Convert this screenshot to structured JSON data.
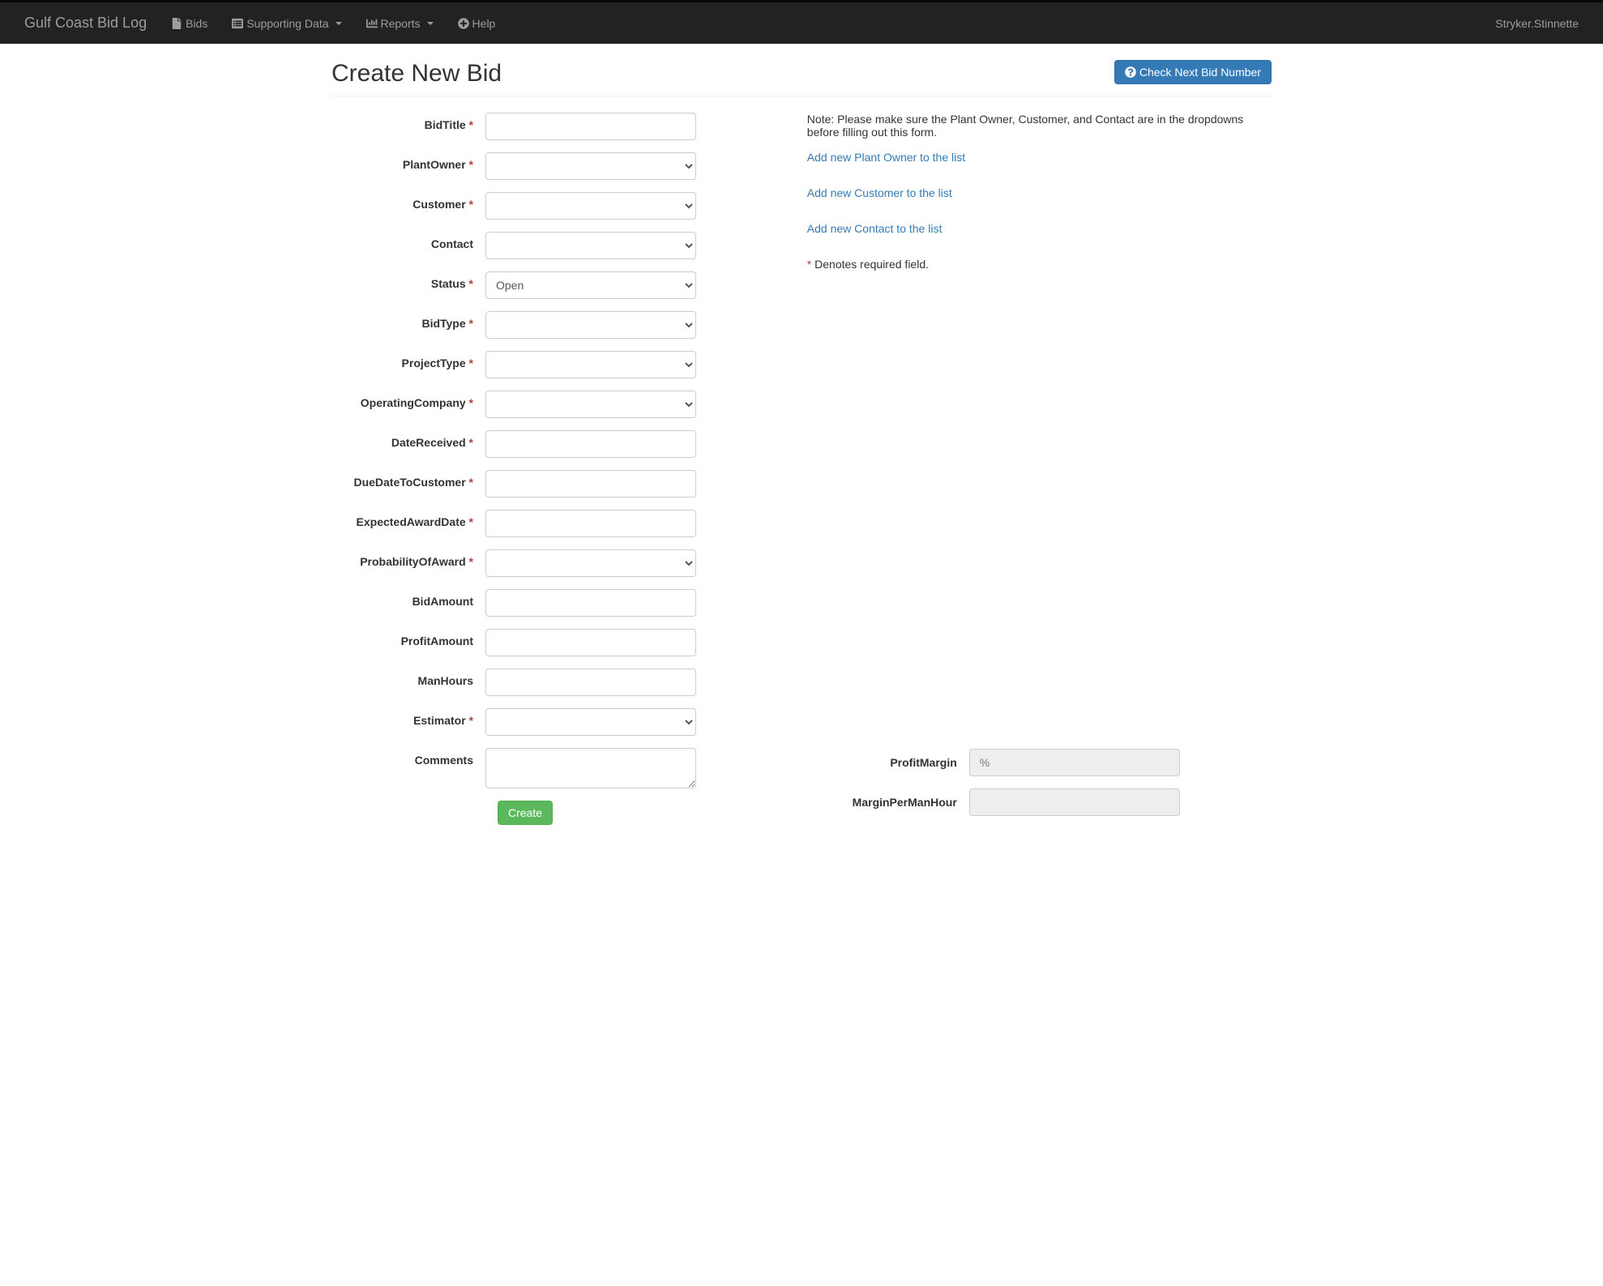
{
  "nav": {
    "brand": "Gulf Coast Bid Log",
    "items": {
      "bids": "Bids",
      "supportingData": "Supporting Data",
      "reports": "Reports",
      "help": "Help"
    },
    "user": "Stryker.Stinnette"
  },
  "page": {
    "title": "Create New Bid",
    "checkNextBidNumber": "Check Next Bid Number"
  },
  "form": {
    "labels": {
      "bidTitle": "BidTitle",
      "plantOwner": "PlantOwner",
      "customer": "Customer",
      "contact": "Contact",
      "status": "Status",
      "bidType": "BidType",
      "projectType": "ProjectType",
      "operatingCompany": "OperatingCompany",
      "dateReceived": "DateReceived",
      "dueDateToCustomer": "DueDateToCustomer",
      "expectedAwardDate": "ExpectedAwardDate",
      "probabilityOfAward": "ProbabilityOfAward",
      "bidAmount": "BidAmount",
      "profitAmount": "ProfitAmount",
      "manHours": "ManHours",
      "estimator": "Estimator",
      "comments": "Comments",
      "profitMargin": "ProfitMargin",
      "marginPerManHour": "MarginPerManHour"
    },
    "values": {
      "status": "Open"
    },
    "placeholders": {
      "profitMargin": "%"
    },
    "required": {
      "bidTitle": true,
      "plantOwner": true,
      "customer": true,
      "contact": false,
      "status": true,
      "bidType": true,
      "projectType": true,
      "operatingCompany": true,
      "dateReceived": true,
      "dueDateToCustomer": true,
      "expectedAwardDate": true,
      "probabilityOfAward": true,
      "bidAmount": false,
      "profitAmount": false,
      "manHours": false,
      "estimator": true,
      "comments": false
    },
    "submit": "Create"
  },
  "side": {
    "note": "Note: Please make sure the Plant Owner, Customer, and Contact are in the dropdowns before filling out this form.",
    "links": {
      "plantOwner": "Add new Plant Owner to the list",
      "customer": "Add new Customer to the list",
      "contact": "Add new Contact to the list"
    },
    "denotesAsterisk": "*",
    "denotes": " Denotes required field."
  }
}
